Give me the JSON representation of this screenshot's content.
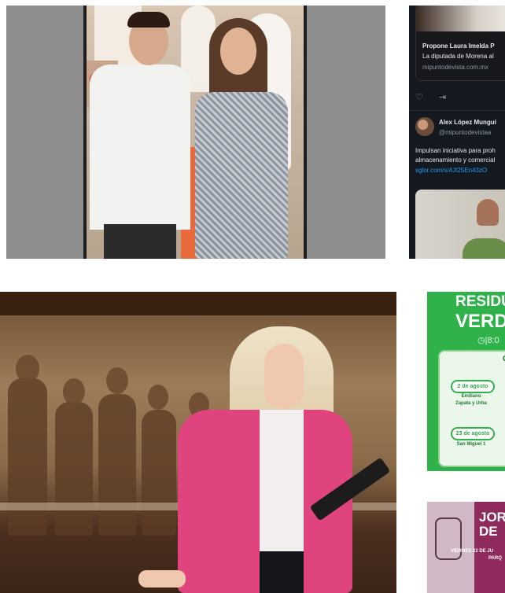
{
  "feed": {
    "post1": {
      "title": "Propone Laura Imelda P",
      "subtitle": "La diputada de Morena al",
      "source": "mipuntodevista.com.mx"
    },
    "post2": {
      "author": "Alex López Munguí",
      "handle": "@mipuntodevistaa",
      "line1": "Impulsan iniciativa para proh",
      "line2": "almacenamiento y comercial",
      "link": "sglor.com/s/4Jt25En43zO"
    }
  },
  "green_poster": {
    "title_line1": "RESIDU",
    "title_line2": "VERD",
    "clock_text": "|8:0",
    "col_label": "C",
    "date1": "2 de agosto",
    "place1_line1": "Emiliano",
    "place1_line2": "Zapata y Urba",
    "date2": "23 de agosto",
    "place2": "San Miguel 1"
  },
  "purple_poster": {
    "title_line1": "JOR",
    "title_line2": "DE",
    "date_line": "VIERNES 22 DE JU",
    "place_line": "PARQ"
  },
  "colors": {
    "page_bg": "#ffffff",
    "gray_frame": "#8e8e8e",
    "feed_bg": "#14181f",
    "feed_link": "#1d9bf0",
    "poster_green": "#2fb24a",
    "poster_purple": "#8e2a5c",
    "blazer_pink": "#e0447f"
  }
}
